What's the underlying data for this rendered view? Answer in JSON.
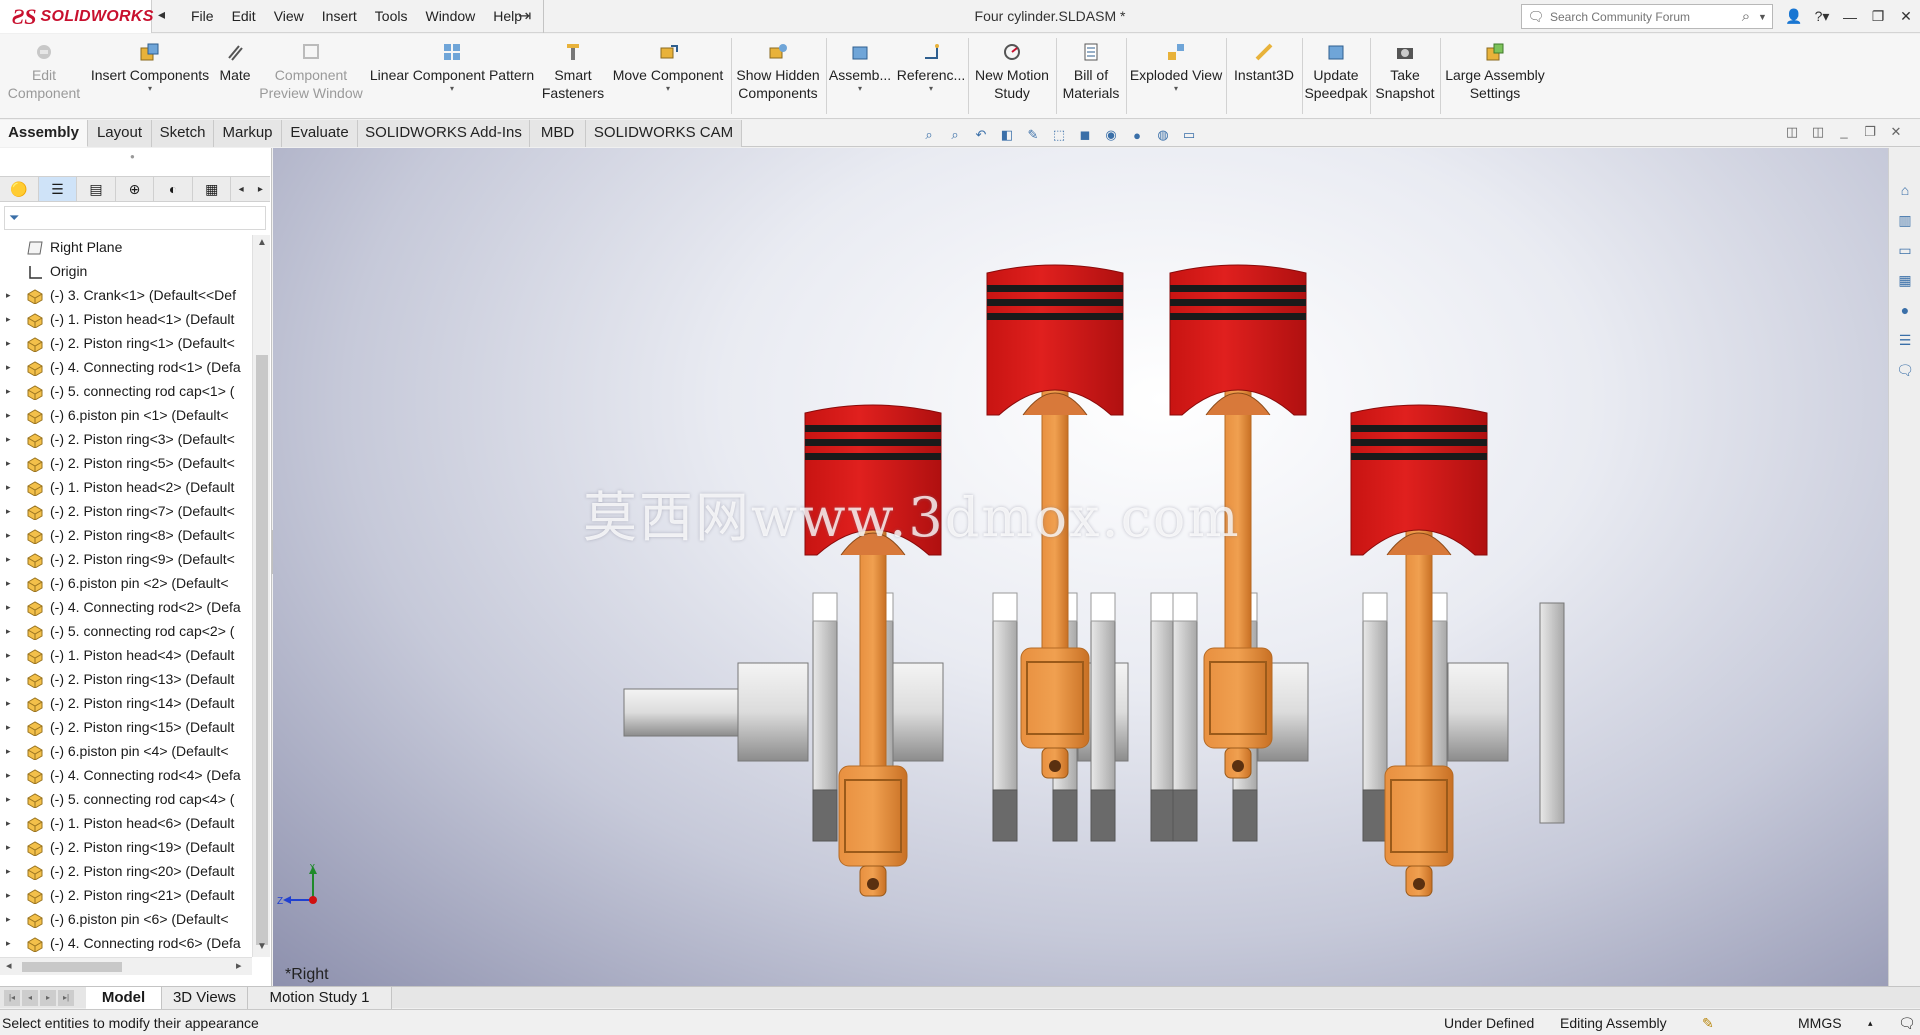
{
  "app": {
    "logo_text": "SOLIDWORKS",
    "menu": [
      "File",
      "Edit",
      "View",
      "Insert",
      "Tools",
      "Window",
      "Help"
    ],
    "document_title": "Four cylinder.SLDASM *",
    "search_placeholder": "Search Community Forum"
  },
  "toolbar": {
    "buttons": [
      {
        "line1": "Edit",
        "line2": "Component",
        "icon": "edit-component-icon"
      },
      {
        "line1": "Insert Components",
        "line2": "",
        "icon": "insert-components-icon"
      },
      {
        "line1": "Mate",
        "line2": "",
        "icon": "mate-icon"
      },
      {
        "line1": "Component",
        "line2": "Preview Window",
        "icon": "preview-window-icon"
      },
      {
        "line1": "Linear Component Pattern",
        "line2": "",
        "icon": "linear-pattern-icon"
      },
      {
        "line1": "Smart",
        "line2": "Fasteners",
        "icon": "smart-fasteners-icon"
      },
      {
        "line1": "Move Component",
        "line2": "",
        "icon": "move-component-icon"
      },
      {
        "line1": "Show Hidden",
        "line2": "Components",
        "icon": "show-hidden-icon"
      },
      {
        "line1": "Assemb...",
        "line2": "",
        "icon": "assembly-features-icon"
      },
      {
        "line1": "Referenc...",
        "line2": "",
        "icon": "reference-geometry-icon"
      },
      {
        "line1": "New Motion",
        "line2": "Study",
        "icon": "motion-study-icon"
      },
      {
        "line1": "Bill of",
        "line2": "Materials",
        "icon": "bom-icon"
      },
      {
        "line1": "Exploded View",
        "line2": "",
        "icon": "exploded-view-icon"
      },
      {
        "line1": "Instant3D",
        "line2": "",
        "icon": "instant3d-icon"
      },
      {
        "line1": "Update",
        "line2": "Speedpak",
        "icon": "speedpak-icon"
      },
      {
        "line1": "Take",
        "line2": "Snapshot",
        "icon": "snapshot-icon"
      },
      {
        "line1": "Large Assembly",
        "line2": "Settings",
        "icon": "large-assembly-icon"
      }
    ]
  },
  "tabs": [
    "Assembly",
    "Layout",
    "Sketch",
    "Markup",
    "Evaluate",
    "SOLIDWORKS Add-Ins",
    "MBD",
    "SOLIDWORKS CAM"
  ],
  "tree": {
    "items": [
      "Right Plane",
      "Origin",
      "(-) 3. Crank<1> (Default<<Def",
      "(-) 1. Piston head<1> (Default",
      "(-) 2. Piston ring<1> (Default<",
      "(-) 4. Connecting rod<1> (Defa",
      "(-) 5. connecting rod cap<1> (",
      "(-) 6.piston pin <1> (Default<",
      "(-) 2. Piston ring<3> (Default<",
      "(-) 2. Piston ring<5> (Default<",
      "(-) 1. Piston head<2> (Default",
      "(-) 2. Piston ring<7> (Default<",
      "(-) 2. Piston ring<8> (Default<",
      "(-) 2. Piston ring<9> (Default<",
      "(-) 6.piston pin <2> (Default<",
      "(-) 4. Connecting rod<2> (Defa",
      "(-) 5. connecting rod cap<2> (",
      "(-) 1. Piston head<4> (Default",
      "(-) 2. Piston ring<13> (Default",
      "(-) 2. Piston ring<14> (Default",
      "(-) 2. Piston ring<15> (Default",
      "(-) 6.piston pin <4> (Default<",
      "(-) 4. Connecting rod<4> (Defa",
      "(-) 5. connecting rod cap<4> (",
      "(-) 1. Piston head<6> (Default",
      "(-) 2. Piston ring<19> (Default",
      "(-) 2. Piston ring<20> (Default",
      "(-) 2. Piston ring<21> (Default",
      "(-) 6.piston pin <6> (Default<",
      "(-) 4. Connecting rod<6> (Defa"
    ]
  },
  "viewport": {
    "view_name": "*Right",
    "watermark": "莫西网www.3dmox.com",
    "triad_y": "Y",
    "triad_z": "Z",
    "colors": {
      "piston": "#e0201e",
      "rod": "#f0a050",
      "crank": "#d8d8d8"
    }
  },
  "bottom_tabs": [
    "Model",
    "3D Views",
    "Motion Study 1"
  ],
  "status": {
    "message": "Select entities to modify their appearance",
    "definition": "Under Defined",
    "mode": "Editing Assembly",
    "units": "MMGS"
  }
}
